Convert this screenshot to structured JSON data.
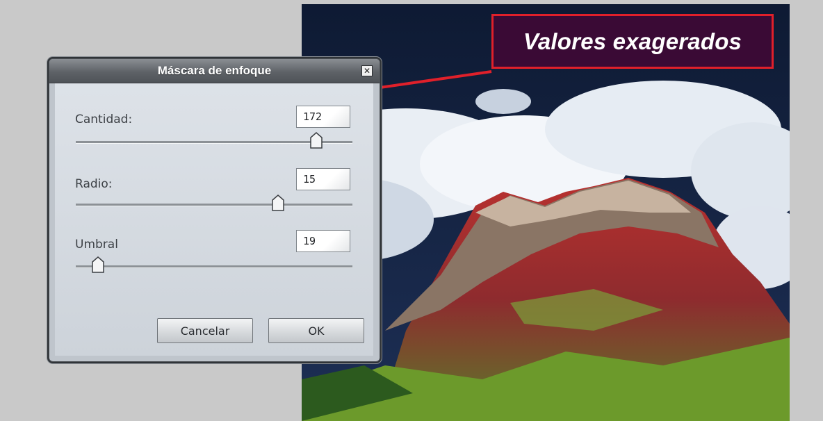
{
  "annotation": {
    "text": "Valores exagerados",
    "border_color": "#e0202a",
    "background": "#3a0a35"
  },
  "dialog": {
    "title": "Máscara de enfoque",
    "close_icon": "close-icon",
    "fields": [
      {
        "label": "Cantidad:",
        "value": "172",
        "slider_fraction": 0.87
      },
      {
        "label": "Radio:",
        "value": "15",
        "slider_fraction": 0.73
      },
      {
        "label": "Umbral",
        "value": "19",
        "slider_fraction": 0.08
      }
    ],
    "buttons": {
      "cancel": "Cancelar",
      "ok": "OK"
    }
  },
  "background_image": {
    "subject": "mountain-photo"
  }
}
